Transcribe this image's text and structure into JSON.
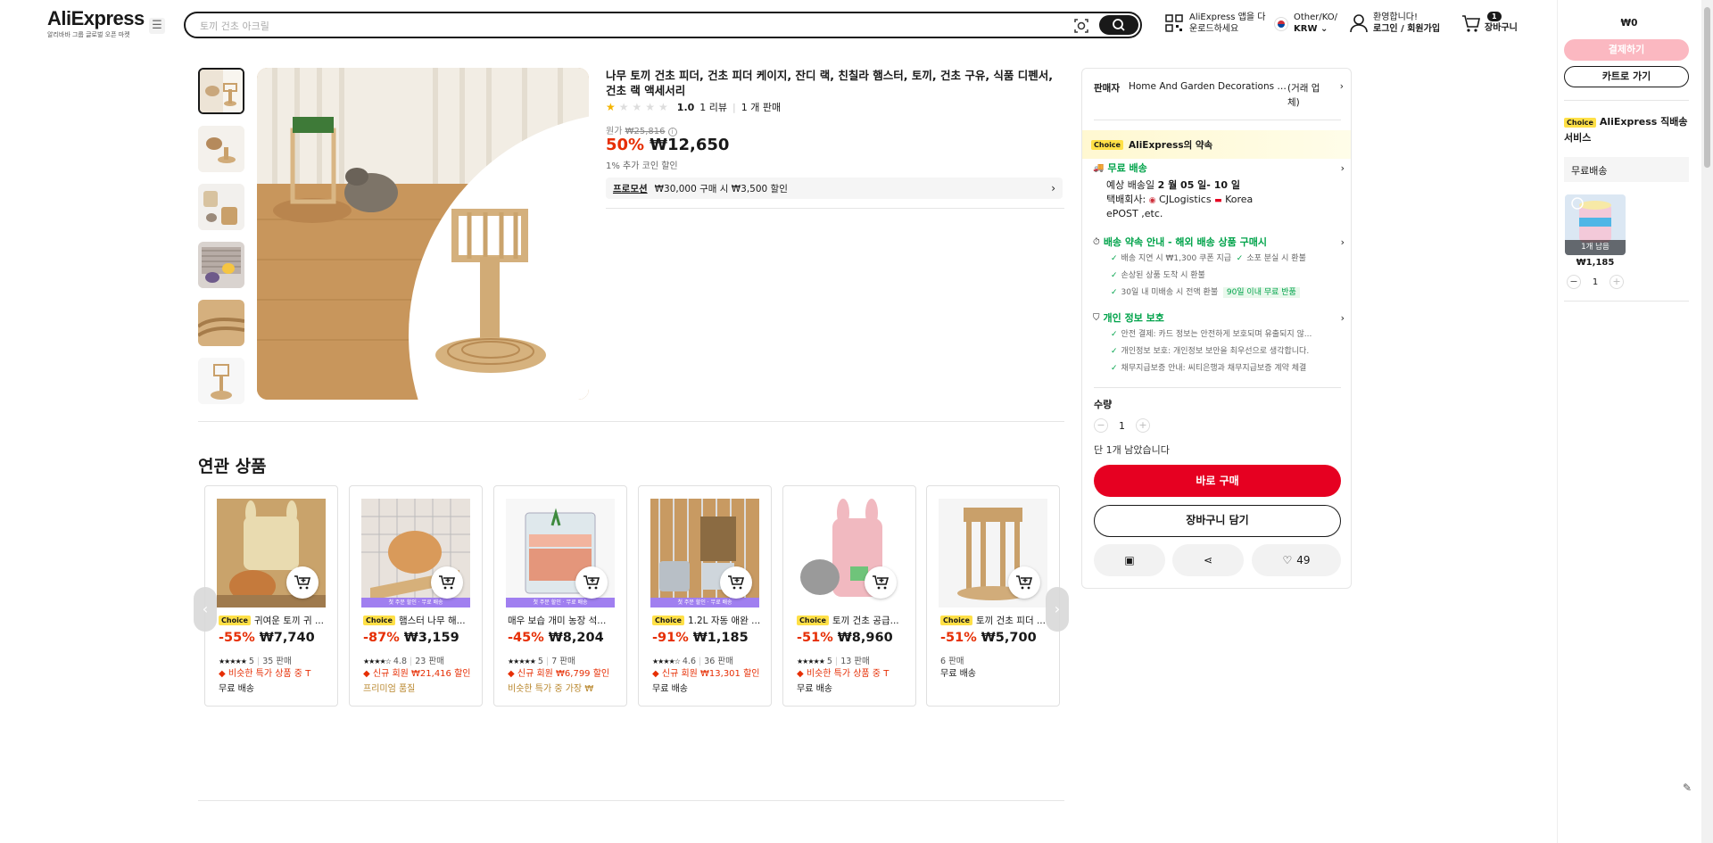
{
  "header": {
    "logo_text": "AliExpress",
    "logo_sub": "알리바바 그룹 글로벌 오픈 마켓",
    "search_placeholder": "토끼 건초 아크릴",
    "app_line1": "AliExpress 앱을 다",
    "app_line2": "운로드하세요",
    "locale_line1": "Other/KO/",
    "locale_line2": "KRW",
    "welcome_line1": "환영합니다!",
    "welcome_line2": "로그인 / 회원가입",
    "cart_count": "1",
    "cart_label": "장바구니"
  },
  "product": {
    "title": "나무 토끼 건초 피더, 건초 피더 케이지, 잔디 랙, 친칠라 햄스터, 토끼, 건초 구유, 식품 디펜서, 건초 랙 액세서리",
    "rating": "1.0",
    "reviews": "1 리뷰",
    "sold": "1 개 판매",
    "stars_filled": 1,
    "orig_label": "원가",
    "orig_price": "₩25,816",
    "discount": "50%",
    "price": "₩12,650",
    "coin_note": "1% 추가 코인 할인",
    "promo_label": "프로모션",
    "promo_text": "₩30,000 구매 시 ₩3,500 할인"
  },
  "related": {
    "title": "연관 상품",
    "items": [
      {
        "choice": "Choice",
        "name": "귀여운 토끼 귀 ...",
        "pct": "-55%",
        "price": "₩7,740",
        "stars": "★★★★★",
        "rating": "5",
        "sold": "35 판매",
        "tag1": "비슷한 특가 상품 중 T",
        "tag2": "무료 배송",
        "band": ""
      },
      {
        "choice": "Choice",
        "name": "햄스터 나무 해...",
        "pct": "-87%",
        "price": "₩3,159",
        "stars": "★★★★☆",
        "rating": "4.8",
        "sold": "23 판매",
        "tag1": "신규 회원 ₩21,416 할인",
        "tag2": "프리미엄 품질",
        "band": "첫 주문 할인 · 무료 배송"
      },
      {
        "choice": "",
        "name": "매우 보습 개미 농장 석...",
        "pct": "-45%",
        "price": "₩8,204",
        "stars": "★★★★★",
        "rating": "5",
        "sold": "7 판매",
        "tag1": "신규 회원 ₩6,799 할인",
        "tag2": "비슷한 특가 중 가장 ₩",
        "band": "첫 주문 할인 · 무료 배송"
      },
      {
        "choice": "Choice",
        "name": "1.2L 자동 애완 ...",
        "pct": "-91%",
        "price": "₩1,185",
        "stars": "★★★★☆",
        "rating": "4.6",
        "sold": "36 판매",
        "tag1": "신규 회원 ₩13,301 할인",
        "tag2": "무료 배송",
        "band": "첫 주문 할인 · 무료 배송"
      },
      {
        "choice": "Choice",
        "name": "토끼 건초 공급...",
        "pct": "-51%",
        "price": "₩8,960",
        "stars": "★★★★★",
        "rating": "5",
        "sold": "13 판매",
        "tag1": "비슷한 특가 상품 중 T",
        "tag2": "무료 배송",
        "band": ""
      },
      {
        "choice": "Choice",
        "name": "토끼 건초 피더 ...",
        "pct": "-51%",
        "price": "₩5,700",
        "stars": "",
        "rating": "",
        "sold": "6 판매",
        "tag1": "",
        "tag2": "무료 배송",
        "band": ""
      }
    ]
  },
  "buybox": {
    "seller_label": "판매자",
    "seller_name": "Home And Garden Decorations S...",
    "seller_type": "(거래 업체)",
    "choice_label": "Choice",
    "choice_text": "AliExpress의 약속",
    "ship_title": "무료 배송",
    "ship_est_pre": "예상 배송일",
    "ship_est": "2 월 05 일- 10 일",
    "courier_label": "택배회사:",
    "courier": "CJLogistics",
    "courier2": "Korea",
    "courier3": "ePOST ,etc.",
    "promise_title": "배송 약속 안내 - 해외 배송 상품 구매시",
    "promise_items": [
      "배송 지연 시 ₩1,300 쿠폰 지급",
      "소포 분실 시 환불",
      "손상된 상품 도착 시 환불",
      "30일 내 미배송 시 전액 환불"
    ],
    "promise_badge": "90일 이내 무료 반품",
    "privacy_title": "개인 정보 보호",
    "privacy_items": [
      "안전 결제: 카드 정보는 안전하게 보호되며 유출되지 않...",
      "개인정보 보호: 개인정보 보안을 최우선으로 생각합니다.",
      "채무지급보증 안내: 씨티은행과 채무지급보증 계약 체결"
    ],
    "qty_label": "수량",
    "qty": "1",
    "stock": "단 1개 남았습니다",
    "buy_now": "바로 구매",
    "add_cart": "장바구니 담기",
    "wish_count": "49"
  },
  "cart_panel": {
    "total": "₩0",
    "checkout": "결제하기",
    "go_cart": "카트로 가기",
    "choice": "Choice",
    "service": "AliExpress 직배송 서비스",
    "free_ship": "무료배송",
    "left_badge": "1개 남음",
    "item_price": "₩1,185",
    "item_qty": "1"
  },
  "colors": {
    "accent_red": "#e62e04",
    "buy_red": "#e60021",
    "choice_yellow": "#ffe047",
    "green": "#00a34a"
  }
}
